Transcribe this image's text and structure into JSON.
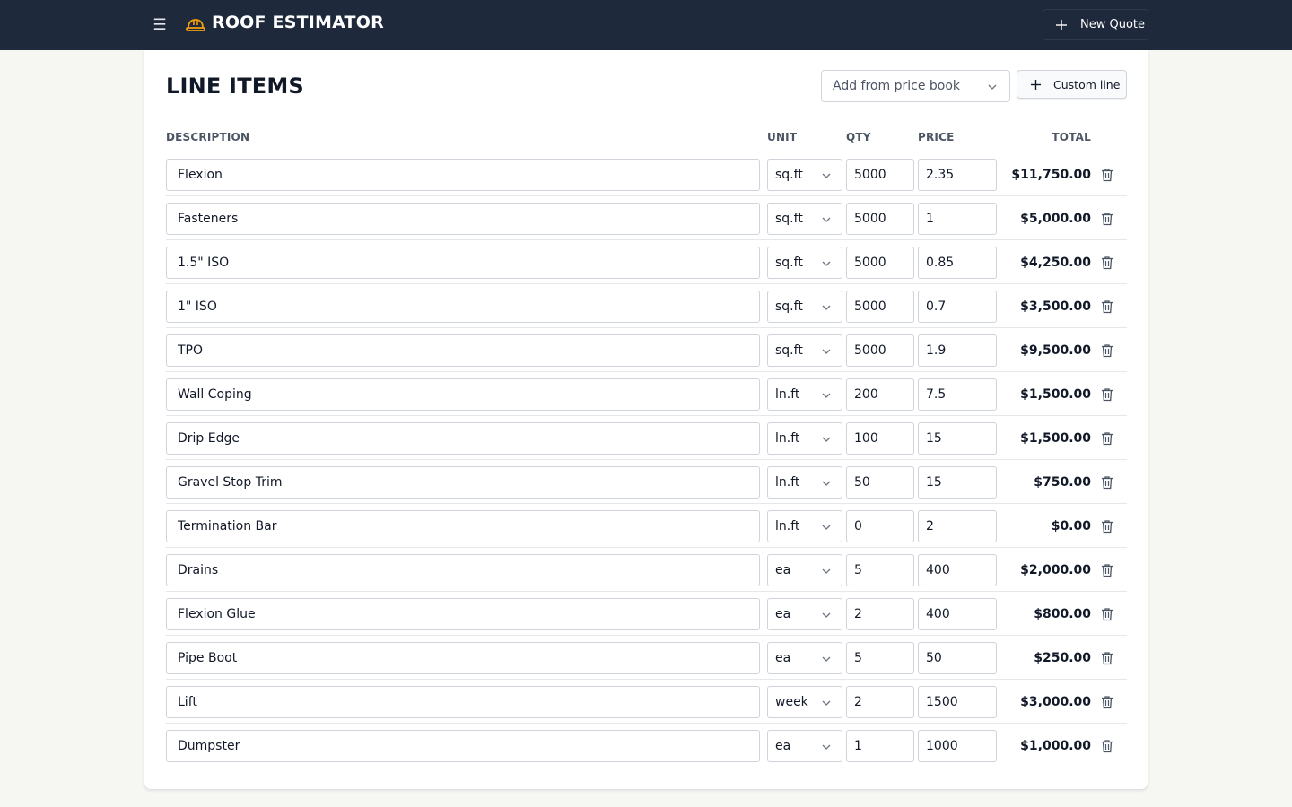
{
  "app": {
    "title": "ROOF ESTIMATOR",
    "brand_icon": "hard-hat-icon",
    "menu_icon": "menu-icon",
    "new_quote_label": "New Quote",
    "accent_color": "#f59e0b",
    "topbar_color": "#1e293b"
  },
  "line_items": {
    "title": "LINE ITEMS",
    "price_book_placeholder": "Add from price book",
    "custom_line_label": "Custom line",
    "columns": {
      "description": "DESCRIPTION",
      "unit": "UNIT",
      "qty": "QTY",
      "price": "PRICE",
      "total": "TOTAL"
    },
    "rows": [
      {
        "description": "Flexion",
        "unit": "sq.ft",
        "qty": "5000",
        "price": "2.35",
        "total": "$11,750.00"
      },
      {
        "description": "Fasteners",
        "unit": "sq.ft",
        "qty": "5000",
        "price": "1",
        "total": "$5,000.00"
      },
      {
        "description": "1.5\" ISO",
        "unit": "sq.ft",
        "qty": "5000",
        "price": "0.85",
        "total": "$4,250.00"
      },
      {
        "description": "1\" ISO",
        "unit": "sq.ft",
        "qty": "5000",
        "price": "0.7",
        "total": "$3,500.00"
      },
      {
        "description": "TPO",
        "unit": "sq.ft",
        "qty": "5000",
        "price": "1.9",
        "total": "$9,500.00"
      },
      {
        "description": "Wall Coping",
        "unit": "ln.ft",
        "qty": "200",
        "price": "7.5",
        "total": "$1,500.00"
      },
      {
        "description": "Drip Edge",
        "unit": "ln.ft",
        "qty": "100",
        "price": "15",
        "total": "$1,500.00"
      },
      {
        "description": "Gravel Stop Trim",
        "unit": "ln.ft",
        "qty": "50",
        "price": "15",
        "total": "$750.00"
      },
      {
        "description": "Termination Bar",
        "unit": "ln.ft",
        "qty": "0",
        "price": "2",
        "total": "$0.00"
      },
      {
        "description": "Drains",
        "unit": "ea",
        "qty": "5",
        "price": "400",
        "total": "$2,000.00"
      },
      {
        "description": "Flexion Glue",
        "unit": "ea",
        "qty": "2",
        "price": "400",
        "total": "$800.00"
      },
      {
        "description": "Pipe Boot",
        "unit": "ea",
        "qty": "5",
        "price": "50",
        "total": "$250.00"
      },
      {
        "description": "Lift",
        "unit": "week",
        "qty": "2",
        "price": "1500",
        "total": "$3,000.00"
      },
      {
        "description": "Dumpster",
        "unit": "ea",
        "qty": "1",
        "price": "1000",
        "total": "$1,000.00"
      }
    ]
  }
}
